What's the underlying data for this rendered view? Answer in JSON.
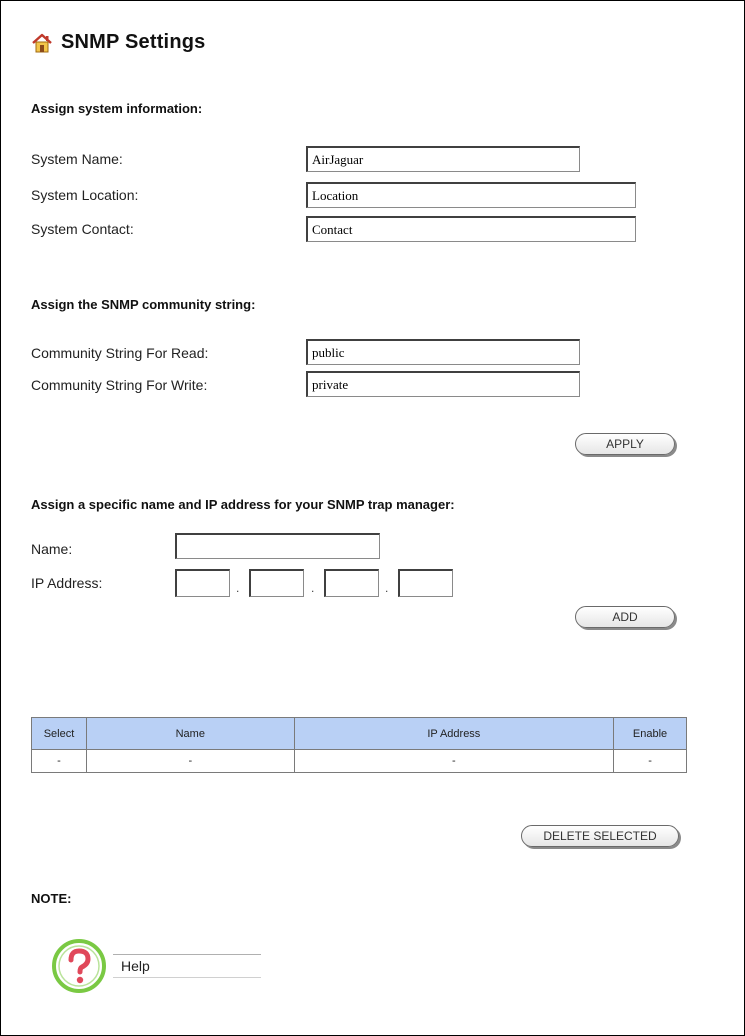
{
  "header": {
    "title": "SNMP Settings",
    "icon": "home-icon"
  },
  "system_info": {
    "section_title": "Assign system information:",
    "name_label": "System Name:",
    "name_value": "AirJaguar",
    "location_label": "System Location:",
    "location_value": "Location",
    "contact_label": "System Contact:",
    "contact_value": "Contact"
  },
  "community": {
    "section_title": "Assign the SNMP community string:",
    "read_label": "Community String For Read:",
    "read_value": "public",
    "write_label": "Community String For Write:",
    "write_value": "private",
    "apply_label": "APPLY"
  },
  "trap_manager": {
    "section_title": "Assign a specific name and IP address for your SNMP trap manager:",
    "name_label": "Name:",
    "name_value": "",
    "ip_label": "IP Address:",
    "ip_octets": [
      "",
      "",
      "",
      ""
    ],
    "add_label": "ADD"
  },
  "trap_table": {
    "columns": [
      "Select",
      "Name",
      "IP Address",
      "Enable"
    ],
    "rows": [
      [
        "-",
        "-",
        "-",
        "-"
      ]
    ],
    "delete_label": "DELETE SELECTED"
  },
  "note": {
    "label": "NOTE:"
  },
  "help": {
    "label": "Help",
    "icon": "help-icon"
  },
  "colors": {
    "table_header_bg": "#b9d0f5",
    "help_ring": "#7ac943",
    "help_mark": "#e0485a"
  }
}
